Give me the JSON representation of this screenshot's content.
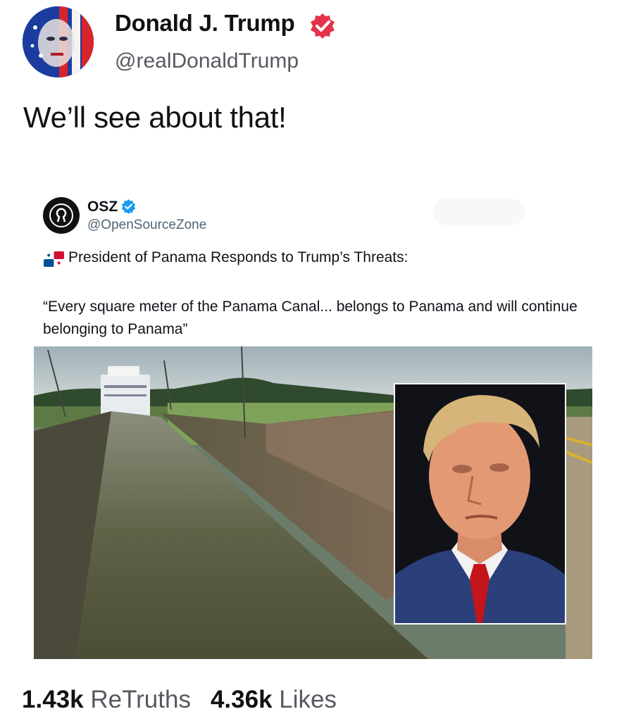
{
  "post": {
    "author_name": "Donald J. Trump",
    "author_handle": "@realDonaldTrump",
    "text": "We’ll see about that!"
  },
  "quoted_post": {
    "author_name": "OSZ",
    "author_handle": "@OpenSourceZone",
    "headline": "President of Panama Responds to Trump’s Threats:",
    "body": "“Every square meter of the Panama Canal... belongs to Panama and will continue belonging to Panama”"
  },
  "stats": {
    "retruths_count": "1.43k",
    "retruths_label": "ReTruths",
    "likes_count": "4.36k",
    "likes_label": "Likes"
  },
  "icons": {
    "verified": "verified-badge-icon",
    "osz_verified": "verified-badge-icon",
    "flag": "panama-flag-icon"
  },
  "colors": {
    "truth_verified": "#e5324b",
    "x_verified": "#1d9bf0",
    "text_primary": "#111111",
    "text_secondary": "#555a60"
  }
}
